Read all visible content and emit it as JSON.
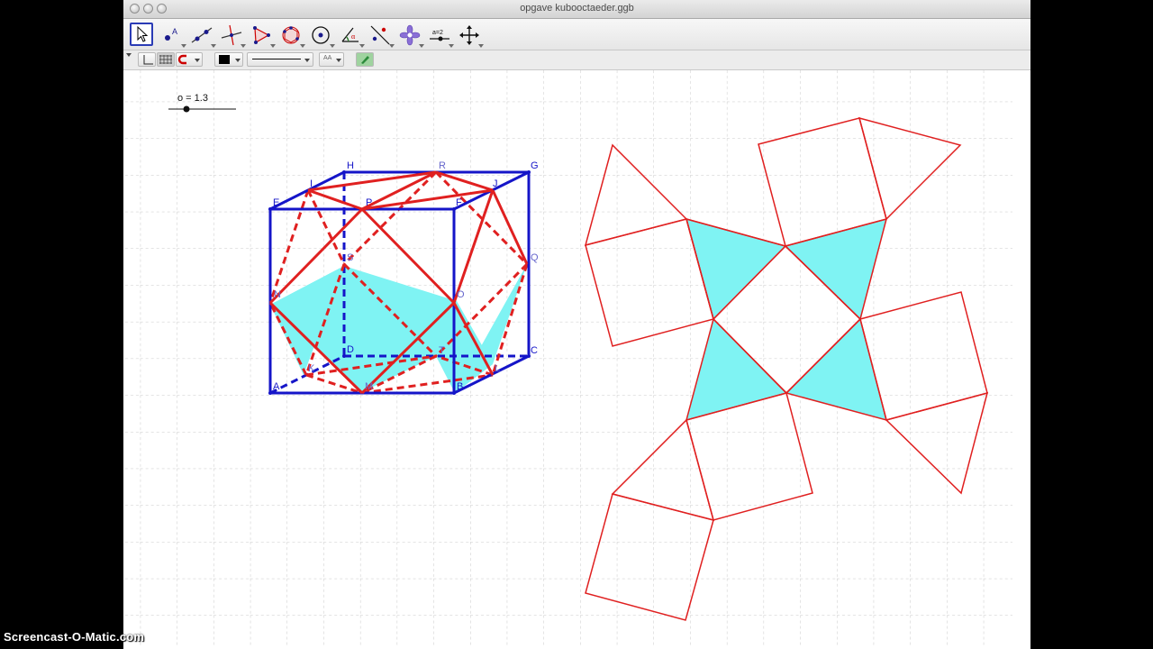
{
  "window": {
    "title": "opgave kubooctaeder.ggb"
  },
  "toolbar": {
    "tools": [
      {
        "name": "move-tool-button",
        "icon": "cursor-arrow-icon",
        "active": true
      },
      {
        "name": "point-tool-button",
        "icon": "point-a-icon",
        "label": "A"
      },
      {
        "name": "line-tool-button",
        "icon": "line-through-points-icon"
      },
      {
        "name": "perpendicular-line-tool-button",
        "icon": "perpendicular-line-icon"
      },
      {
        "name": "polygon-tool-button",
        "icon": "polygon-triangle-icon"
      },
      {
        "name": "regular-polygon-tool-button",
        "icon": "hexagon-circle-icon"
      },
      {
        "name": "circle-tool-button",
        "icon": "circle-center-icon"
      },
      {
        "name": "angle-tool-button",
        "icon": "angle-alpha-icon",
        "label": "α"
      },
      {
        "name": "reflect-tool-button",
        "icon": "reflect-line-icon"
      },
      {
        "name": "transform-tool-button",
        "icon": "flower-transform-icon"
      },
      {
        "name": "slider-tool-button",
        "icon": "slider-a-equals-2-icon",
        "label": "a=2"
      },
      {
        "name": "move-graphics-tool-button",
        "icon": "move-cross-arrows-icon"
      }
    ]
  },
  "stylebar": {
    "text_size_label": "AA",
    "line_color": "#000000",
    "pen_color": "#2b8a3a"
  },
  "slider": {
    "label": "o = 1.3",
    "value": 1.3
  },
  "cube_labels": {
    "E": "E",
    "F": "F",
    "G": "G",
    "H": "H",
    "A": "A",
    "B": "B",
    "C": "C",
    "D": "D",
    "I": "I",
    "J": "J",
    "P": "P",
    "R": "R",
    "Q": "Q",
    "O": "O",
    "N": "N",
    "M": "M",
    "S": "S",
    "T": "T",
    "K": "K",
    "L": "L"
  },
  "colors": {
    "cube_edge": "#1515c8",
    "cuboct_edge": "#e02020",
    "face_fill": "#7ff3f3",
    "grid": "#c8c8c8",
    "point_label": "#6666cc"
  },
  "watermark": "Screencast-O-Matic.com"
}
